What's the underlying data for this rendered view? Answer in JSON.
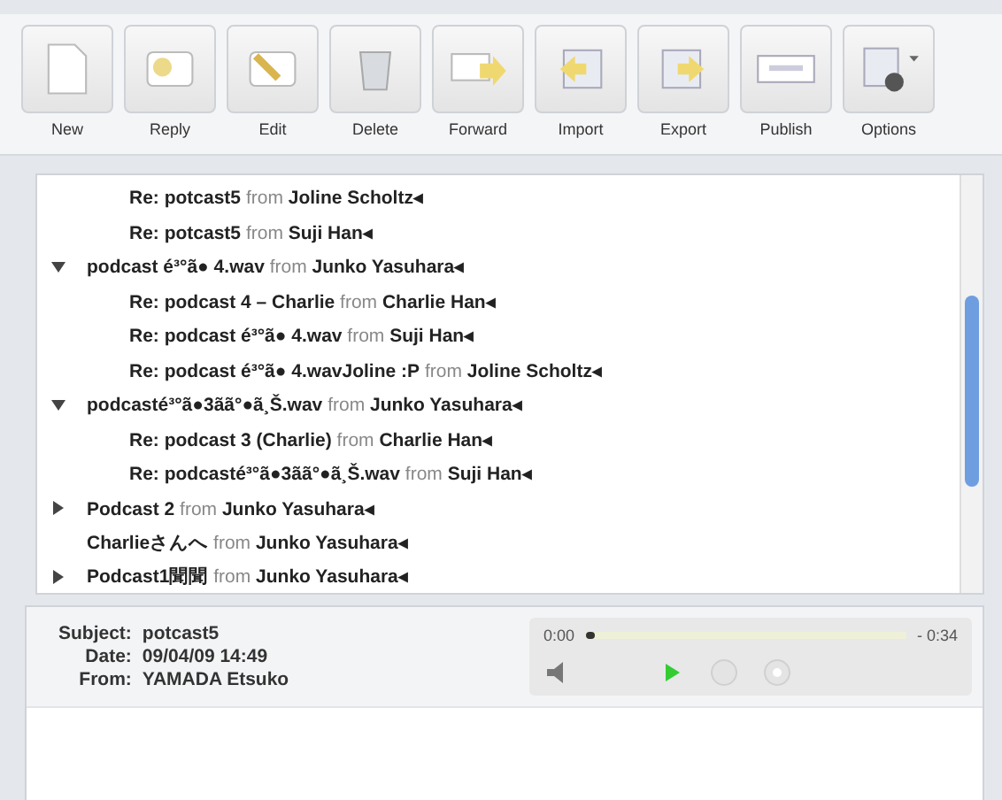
{
  "toolbar": [
    "New",
    "Reply",
    "Edit",
    "Delete",
    "Forward",
    "Import",
    "Export",
    "Publish",
    "Options"
  ],
  "message_list": {
    "continued_replies": [
      {
        "subject": "Re: potcast5",
        "from": "from",
        "sender": "Joline Scholtz◂"
      },
      {
        "subject": "Re: potcast5",
        "from": "from",
        "sender": "Suji Han◂"
      }
    ],
    "threads": [
      {
        "subject": "podcast é³°ã● 4.wav",
        "from": "from",
        "sender": "Junko Yasuhara◂",
        "expanded": true,
        "children": [
          {
            "subject": "Re: podcast 4 – Charlie",
            "from": "from",
            "sender": "Charlie Han◂"
          },
          {
            "subject": "Re: podcast é³°ã● 4.wav",
            "from": "from",
            "sender": "Suji Han◂"
          },
          {
            "subject": "Re: podcast é³°ã● 4.wavJoline :P",
            "from": "from",
            "sender": "Joline Scholtz◂"
          }
        ]
      },
      {
        "subject": "podcasté³°ã●3ãã°●ã¸Š.wav",
        "from": "from",
        "sender": "Junko Yasuhara◂",
        "expanded": true,
        "children": [
          {
            "subject": "Re: podcast 3 (Charlie)",
            "from": "from",
            "sender": "Charlie Han◂"
          },
          {
            "subject": "Re: podcasté³°ã●3ãã°●ã¸Š.wav",
            "from": "from",
            "sender": "Suji Han◂"
          }
        ]
      },
      {
        "subject": "Podcast 2",
        "from": "from",
        "sender": "Junko Yasuhara◂",
        "expanded": false
      },
      {
        "subject": "Charlieさんへ",
        "from": "from",
        "sender": "Junko Yasuhara◂"
      },
      {
        "subject": "Podcast1聞聞",
        "from": "from",
        "sender": "Junko Yasuhara◂",
        "expanded": false
      }
    ]
  },
  "detail": {
    "fields": [
      {
        "label": "Subject:",
        "value": "potcast5"
      },
      {
        "label": "Date:",
        "value": "09/04/09 14:49"
      },
      {
        "label": "From:",
        "value": "YAMADA Etsuko"
      }
    ],
    "player": {
      "elapsed": "0:00",
      "remaining": "- 0:34",
      "level": 0.02
    }
  }
}
